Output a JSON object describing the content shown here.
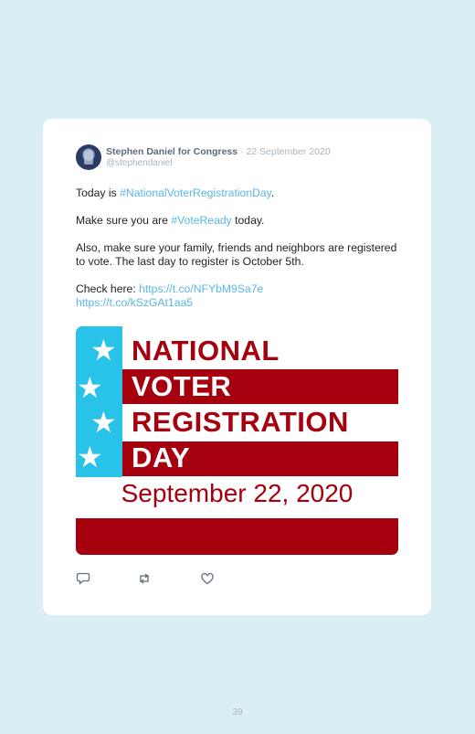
{
  "tweet": {
    "author": "Stephen Daniel for Congress",
    "separator": "·",
    "date": "22 September 2020",
    "handle": "@stephendaniel",
    "line1_prefix": "Today is ",
    "line1_hashtag": "#NationalVoterRegistrationDay",
    "line1_suffix": ".",
    "line2_prefix": "Make sure you are ",
    "line2_hashtag": "#VoteReady",
    "line2_suffix": " today.",
    "line3": "Also, make sure your family, friends and neighbors are registered to vote. The last day to register is October 5th.",
    "line4_prefix": "Check here: ",
    "link1": "https://t.co/NFYbM9Sa7e",
    "link2": "https://t.co/kSzGAt1aa5"
  },
  "banner": {
    "line1": "NATIONAL",
    "line2": "VOTER",
    "line3": "REGISTRATION",
    "line4": "DAY",
    "date": "September 22, 2020",
    "star_glyph": "★"
  },
  "actions": {
    "reply_icon": "reply-icon",
    "retweet_icon": "retweet-icon",
    "like_icon": "heart-icon"
  },
  "colors": {
    "background": "#d9eef5",
    "banner_red": "#a6000e",
    "banner_blue": "#29c2e8",
    "link": "#59b6e6"
  },
  "page_number": "39"
}
